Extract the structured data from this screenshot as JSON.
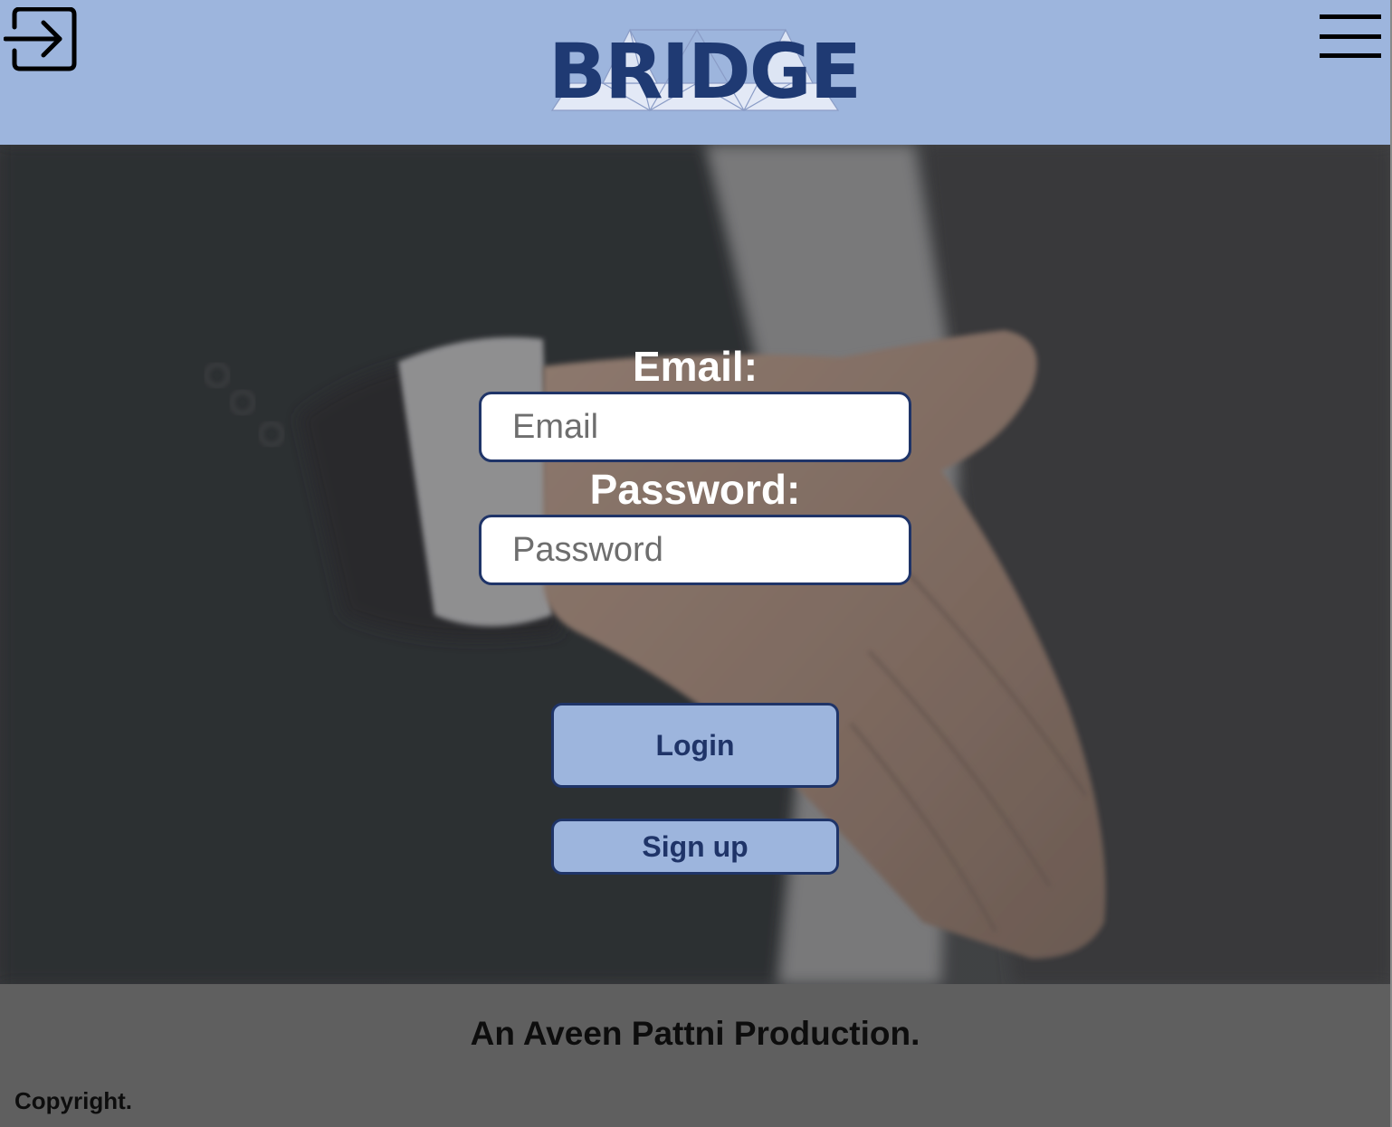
{
  "header": {
    "logo_text": "BRIDGE",
    "login_icon": "login-arrow-icon",
    "menu_icon": "hamburger-menu-icon",
    "background_color": "#9db5dd",
    "brand_color": "#1f3a73"
  },
  "form": {
    "email_label": "Email:",
    "email_placeholder": "Email",
    "email_value": "",
    "password_label": "Password:",
    "password_placeholder": "Password",
    "password_value": "",
    "login_label": "Login",
    "signup_label": "Sign up"
  },
  "hero": {
    "background_image": "handshake-photo"
  },
  "footer": {
    "tagline": "An Aveen Pattni Production.",
    "copyright": "Copyright.",
    "background_color": "#5f5f5f"
  }
}
